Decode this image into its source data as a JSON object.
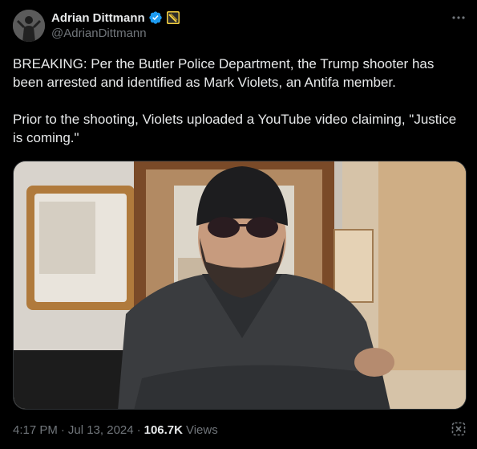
{
  "author": {
    "display_name": "Adrian Dittmann",
    "handle": "@AdrianDittmann",
    "verified": true
  },
  "tweet": {
    "paragraphs": [
      "BREAKING: Per the Butler Police Department, the Trump shooter has been arrested and identified as Mark Violets, an Antifa member.",
      "Prior to the shooting, Violets uploaded a YouTube video claiming, \"Justice is coming.\""
    ]
  },
  "meta": {
    "time": "4:17 PM",
    "date": "Jul 13, 2024",
    "views_count": "106.7K",
    "views_label": "Views"
  },
  "icons": {
    "verified": "verified-badge-icon",
    "affiliate": "affiliate-badge-icon",
    "more": "more-options-icon",
    "grok": "grok-icon"
  },
  "colors": {
    "background": "#000000",
    "text_primary": "#e7e9ea",
    "text_secondary": "#71767b",
    "verified_blue": "#1d9bf0",
    "border": "#2f3336"
  }
}
